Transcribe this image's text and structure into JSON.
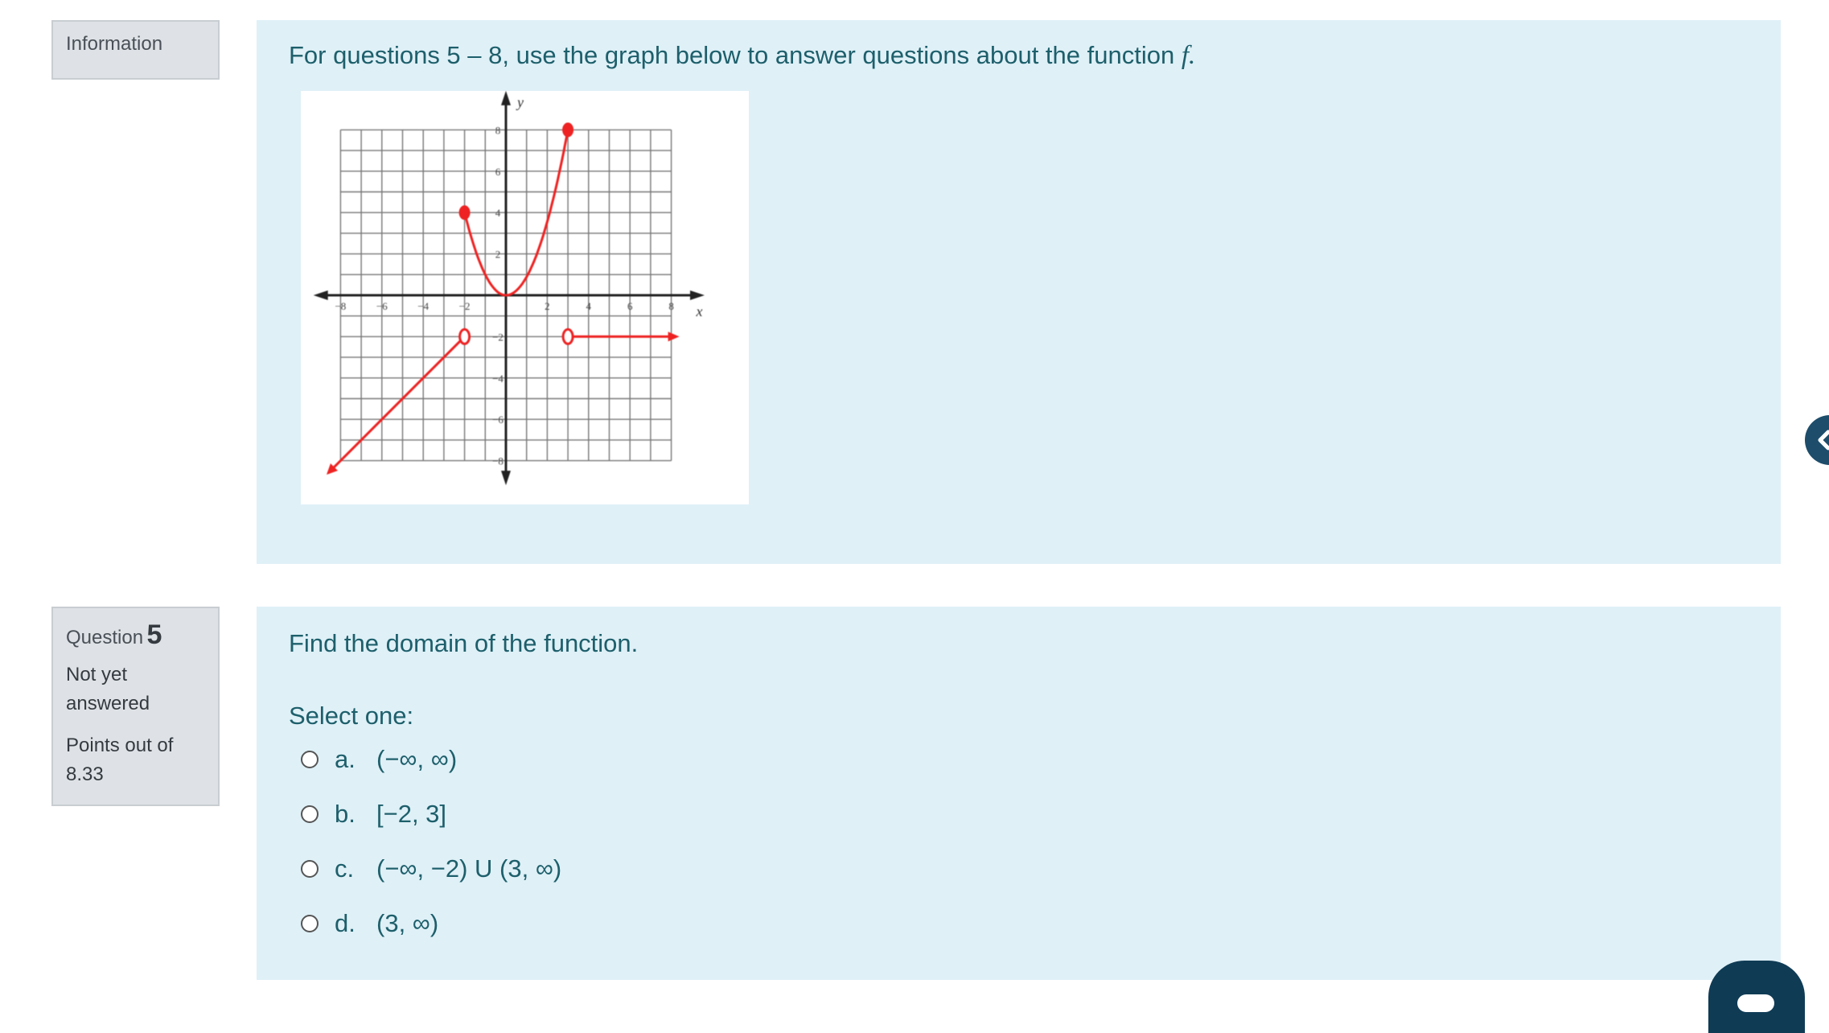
{
  "info_block": {
    "label": "Information"
  },
  "info_panel": {
    "prefix": "For questions 5 – 8, use the graph below to answer questions about the function ",
    "function_name": "f.",
    "graph": {
      "x_axis_label": "x",
      "y_axis_label": "y",
      "x_tick_labels": [
        "−8",
        "−6",
        "−4",
        "−2",
        "2",
        "4",
        "6",
        "8"
      ],
      "y_tick_labels": [
        "8",
        "6",
        "4",
        "2",
        "−2",
        "−4",
        "−6",
        "−8"
      ],
      "curve_color": "#ee2222"
    }
  },
  "question": {
    "label": "Question",
    "number": "5",
    "state": "Not yet answered",
    "grade": "Points out of 8.33",
    "text": "Find the domain of the function.",
    "prompt": "Select one:",
    "options": [
      {
        "letter": "a.",
        "text": "(−∞, ∞)"
      },
      {
        "letter": "b.",
        "text": "[−2, 3]"
      },
      {
        "letter": "c.",
        "text": "(−∞, −2) U (3, ∞)"
      },
      {
        "letter": "d.",
        "text": "(3, ∞)"
      }
    ]
  },
  "colors": {
    "panel_bg": "#dff0f7",
    "info_box_bg": "#dee2e6",
    "text": "#1d5f6b",
    "drawer_toggle": "#1d4d6b"
  },
  "icons": {
    "drawer_toggle": "chevron-left-icon",
    "chat": "chat-icon"
  }
}
